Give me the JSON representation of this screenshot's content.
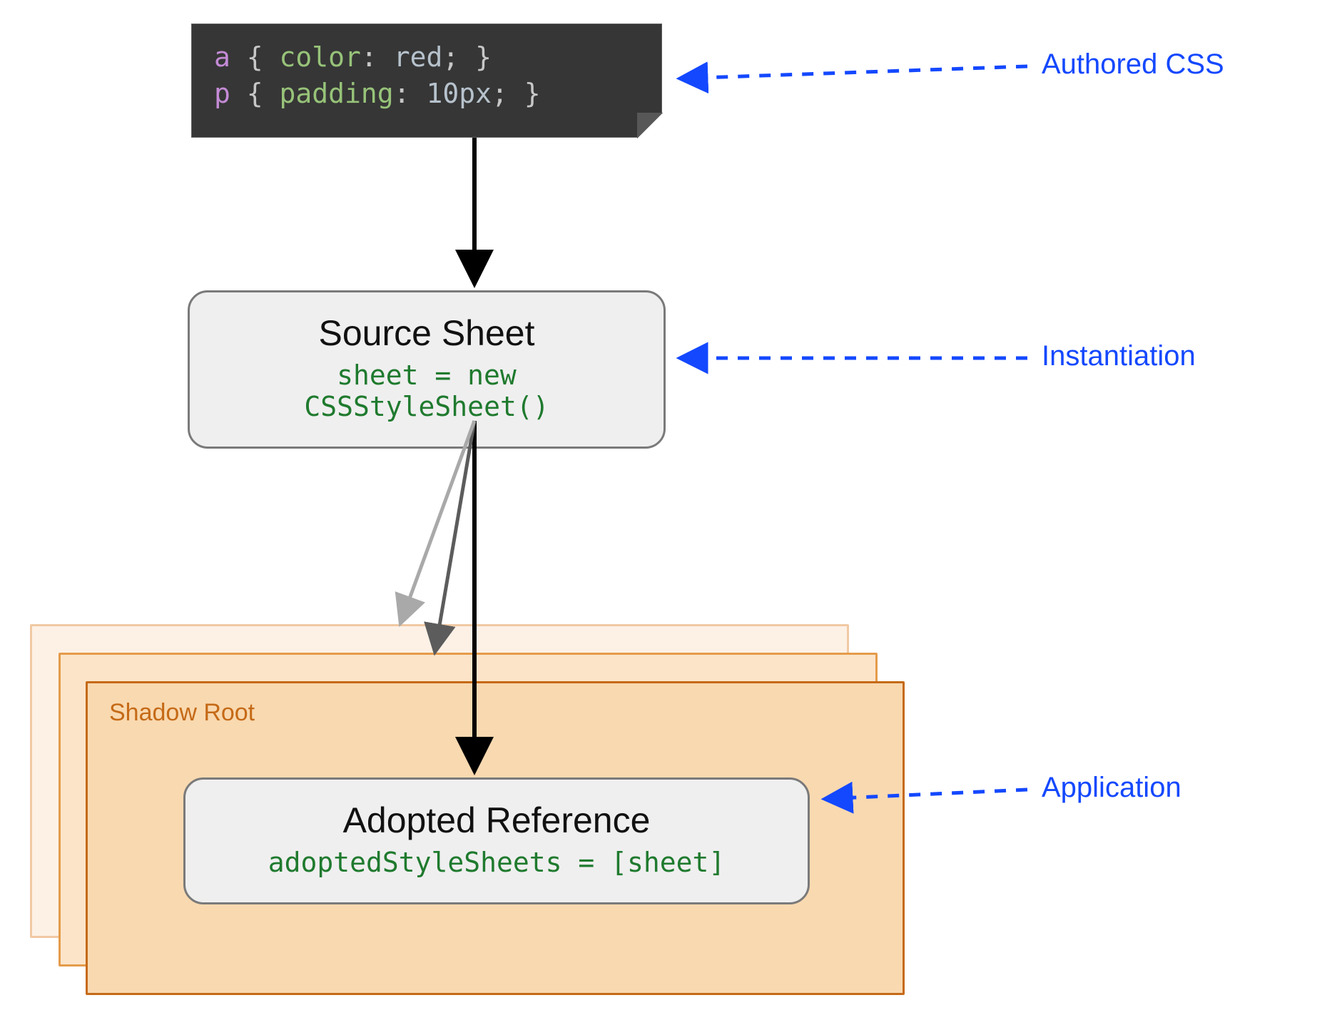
{
  "code": {
    "line1": {
      "selector": "a",
      "brace_open": " { ",
      "prop": "color",
      "colon_space": ": ",
      "value": "red",
      "semicolon_brace": "; }"
    },
    "line2": {
      "selector": "p",
      "brace_open": " { ",
      "prop": "padding",
      "colon_space": ": ",
      "value": "10px",
      "semicolon_brace": "; }"
    }
  },
  "source_sheet": {
    "title": "Source Sheet",
    "code": "sheet = new CSSStyleSheet()"
  },
  "shadow_root": {
    "label": "Shadow Root"
  },
  "adopted": {
    "title": "Adopted Reference",
    "code": "adoptedStyleSheets = [sheet]"
  },
  "annotations": {
    "authored": "Authored CSS",
    "instantiation": "Instantiation",
    "application": "Application"
  }
}
